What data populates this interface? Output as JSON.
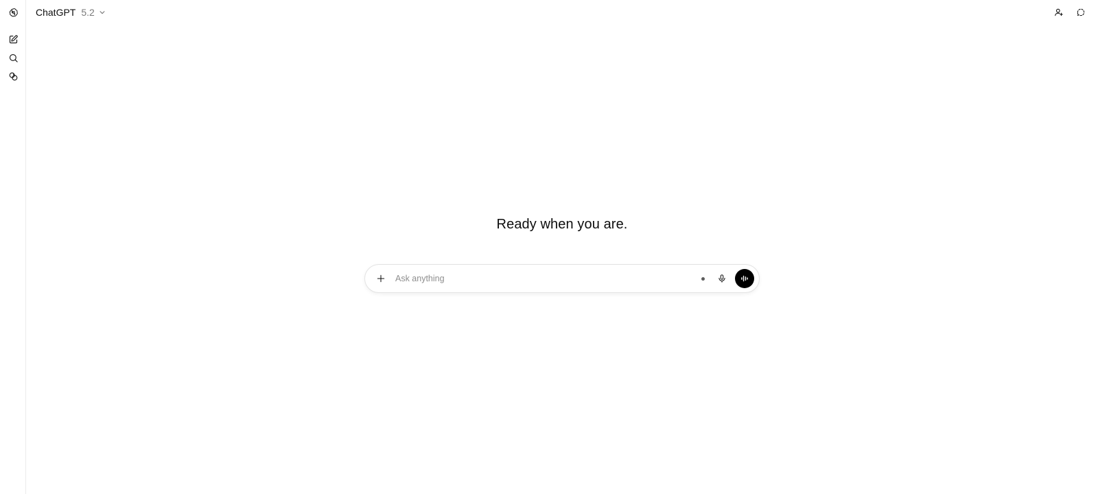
{
  "header": {
    "model_name": "ChatGPT",
    "model_version": "5.2"
  },
  "main": {
    "greeting": "Ready when you are."
  },
  "composer": {
    "placeholder": "Ask anything"
  },
  "icons": {
    "rail": [
      "openai-logo-icon",
      "new-chat-icon",
      "search-icon",
      "images-icon"
    ],
    "top_right": [
      "add-people-icon",
      "temporary-chat-icon"
    ],
    "composer": [
      "plus-icon",
      "microphone-icon",
      "voice-mode-icon"
    ]
  },
  "colors": {
    "voice_button": "#000000",
    "placeholder": "#8e8e8e",
    "version_text": "#7a7a7a"
  }
}
